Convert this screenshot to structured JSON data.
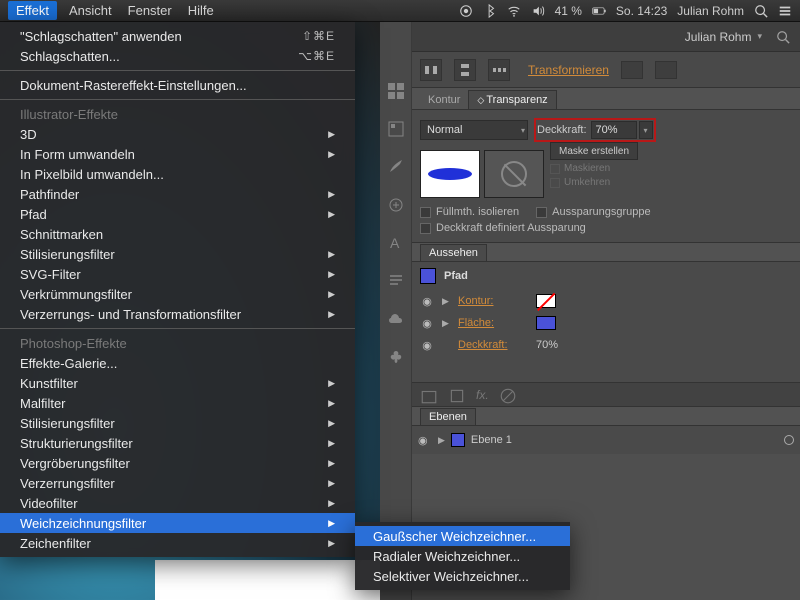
{
  "menubar": {
    "active_menu": "Effekt",
    "items": [
      "Ansicht",
      "Fenster",
      "Hilfe"
    ],
    "battery": "41 %",
    "clock": "So. 14:23",
    "user": "Julian Rohm"
  },
  "dropdown": {
    "apply_last": "\"Schlagschatten\" anwenden",
    "apply_last_sc": "⇧⌘E",
    "last": "Schlagschatten...",
    "last_sc": "⌥⌘E",
    "raster": "Dokument-Rastereffekt-Einstellungen...",
    "section_ai": "Illustrator-Effekte",
    "ai_items": [
      "3D",
      "In Form umwandeln",
      "In Pixelbild umwandeln...",
      "Pathfinder",
      "Pfad",
      "Schnittmarken",
      "Stilisierungsfilter",
      "SVG-Filter",
      "Verkrümmungsfilter",
      "Verzerrungs- und Transformationsfilter"
    ],
    "section_ps": "Photoshop-Effekte",
    "ps_gallery": "Effekte-Galerie...",
    "ps_items": [
      "Kunstfilter",
      "Malfilter",
      "Stilisierungsfilter",
      "Strukturierungsfilter",
      "Vergröberungsfilter",
      "Verzerrungsfilter",
      "Videofilter",
      "Weichzeichnungsfilter",
      "Zeichenfilter"
    ]
  },
  "submenu": {
    "items": [
      "Gaußscher Weichzeichner...",
      "Radialer Weichzeichner...",
      "Selektiver Weichzeichner..."
    ]
  },
  "apptab": {
    "user": "Julian Rohm"
  },
  "toolbar": {
    "transform": "Transformieren"
  },
  "trans": {
    "tab_kontur": "Kontur",
    "tab_trans": "Transparenz",
    "blend": "Normal",
    "opacity_label": "Deckkraft:",
    "opacity_value": "70%",
    "mask_btn": "Maske erstellen",
    "mask_chk1": "Maskieren",
    "mask_chk2": "Umkehren",
    "chk1": "Füllmth. isolieren",
    "chk2": "Aussparungsgruppe",
    "chk3": "Deckkraft definiert Aussparung"
  },
  "auss": {
    "title_tab": "Aussehen",
    "path": "Pfad",
    "stroke": "Kontur:",
    "fill": "Fläche:",
    "opacity": "Deckkraft:",
    "opacity_val": "70%"
  },
  "ebenen": {
    "title_tab": "Ebenen",
    "layer": "Ebene 1"
  }
}
